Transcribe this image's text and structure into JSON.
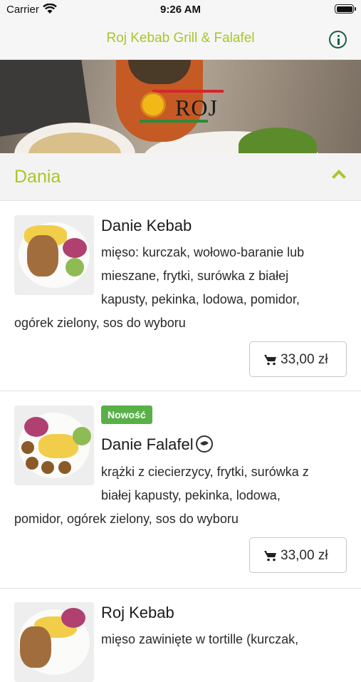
{
  "status_bar": {
    "carrier": "Carrier",
    "time": "9:26 AM"
  },
  "nav": {
    "title": "Roj Kebab Grill & Falafel",
    "info_icon": "info-icon"
  },
  "hero": {
    "logo_text": "ROJ"
  },
  "section": {
    "title": "Dania",
    "toggle_icon": "chevron-up-icon"
  },
  "items": [
    {
      "title": "Danie Kebab",
      "desc_lines": [
        "mięso: kurczak, wołowo-baranie lub",
        "mieszane, frytki, surówka z białej",
        "kapusty, pekinka, lodowa, pomidor,",
        "ogórek zielony, sos do wyboru"
      ],
      "price": "33,00 zł"
    },
    {
      "badge": "Nowość",
      "title": "Danie Falafel",
      "desc_lines": [
        "krążki z ciecierzycy, frytki, surówka z",
        "białej kapusty, pekinka, lodowa,",
        "pomidor, ogórek zielony, sos do wyboru"
      ],
      "price": "33,00 zł"
    },
    {
      "title": "Roj Kebab",
      "desc_lines": [
        "mięso zawinięte w tortille (kurczak,"
      ]
    }
  ],
  "colors": {
    "accent": "#a8c62a",
    "info": "#1e5c4a",
    "badge": "#59b049"
  }
}
